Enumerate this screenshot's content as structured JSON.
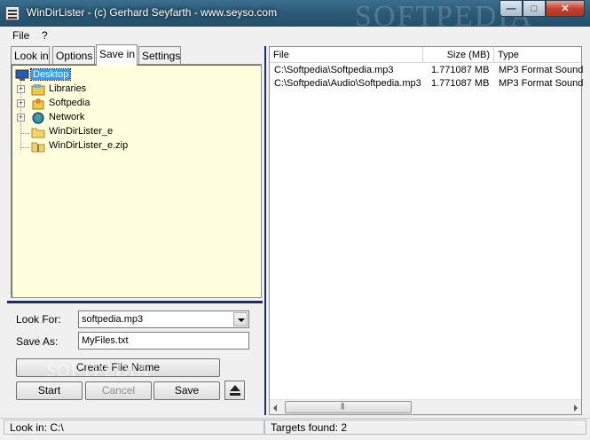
{
  "window": {
    "title": "WinDirLister - (c) Gerhard Seyfarth - www.seyso.com",
    "watermark": "SOFTPEDIA"
  },
  "menu": {
    "items": [
      "File",
      "?"
    ]
  },
  "tabs": [
    {
      "label": "Look in",
      "active": false
    },
    {
      "label": "Options",
      "active": false
    },
    {
      "label": "Save in",
      "active": true
    },
    {
      "label": "Settings",
      "active": false
    }
  ],
  "tree": {
    "items": [
      {
        "label": "Desktop",
        "icon": "desktop-icon",
        "selected": true,
        "expander": "-"
      },
      {
        "label": "Libraries",
        "icon": "libraries-icon",
        "expander": "+"
      },
      {
        "label": "Softpedia",
        "icon": "user-folder-icon",
        "expander": "+"
      },
      {
        "label": "Network",
        "icon": "network-icon",
        "expander": "+"
      },
      {
        "label": "WinDirLister_e",
        "icon": "folder-icon",
        "expander": ""
      },
      {
        "label": "WinDirLister_e.zip",
        "icon": "zip-folder-icon",
        "expander": ""
      }
    ]
  },
  "form": {
    "look_for_label": "Look For:",
    "look_for_value": "softpedia.mp3",
    "save_as_label": "Save As:",
    "save_as_value": "MyFiles.txt"
  },
  "buttons": {
    "create_file_name": "Create File Name",
    "start": "Start",
    "cancel": "Cancel",
    "save": "Save"
  },
  "results": {
    "columns": [
      "File",
      "Size (MB)",
      "Type"
    ],
    "rows": [
      {
        "file": "C:\\Softpedia\\Softpedia.mp3",
        "size": "1.771087 MB",
        "type": "MP3 Format Sound"
      },
      {
        "file": "C:\\Softpedia\\Audio\\Softpedia.mp3",
        "size": "1.771087 MB",
        "type": "MP3 Format Sound"
      }
    ]
  },
  "status": {
    "look_in": "Look in: C:\\",
    "targets": "Targets found: 2"
  },
  "colors": {
    "tree_background": "#ffffdd",
    "splitter": "#1e2a6e",
    "selection": "#3399ff"
  }
}
